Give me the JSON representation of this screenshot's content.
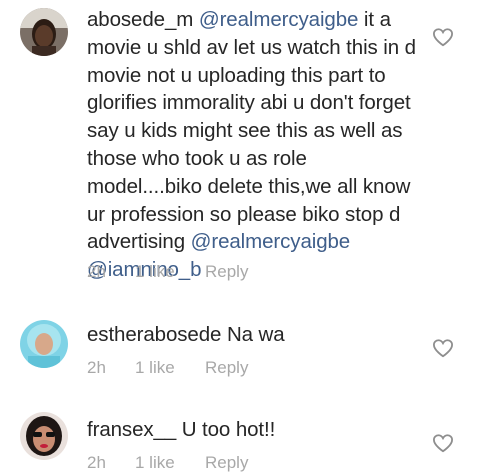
{
  "comments": [
    {
      "username": "abosede_m",
      "mention1": "@realmercyaigbe",
      "body": " it a movie u shld av let us watch this in d movie not u uploading this part to glorifies immorality abi u don't forget say u kids might see this as well as those who took u as role model....biko delete this,we all know ur profession so please biko stop d advertising ",
      "mention2": "@realmercyaigbe",
      "mention3": "@iamnino_b",
      "time": "2h",
      "likes": "1 like",
      "reply": "Reply"
    },
    {
      "username": "estherabosede",
      "body": " Na wa",
      "time": "2h",
      "likes": "1 like",
      "reply": "Reply"
    },
    {
      "username": "fransex__",
      "body": " U too hot!!",
      "time": "2h",
      "likes": "1 like",
      "reply": "Reply"
    }
  ]
}
